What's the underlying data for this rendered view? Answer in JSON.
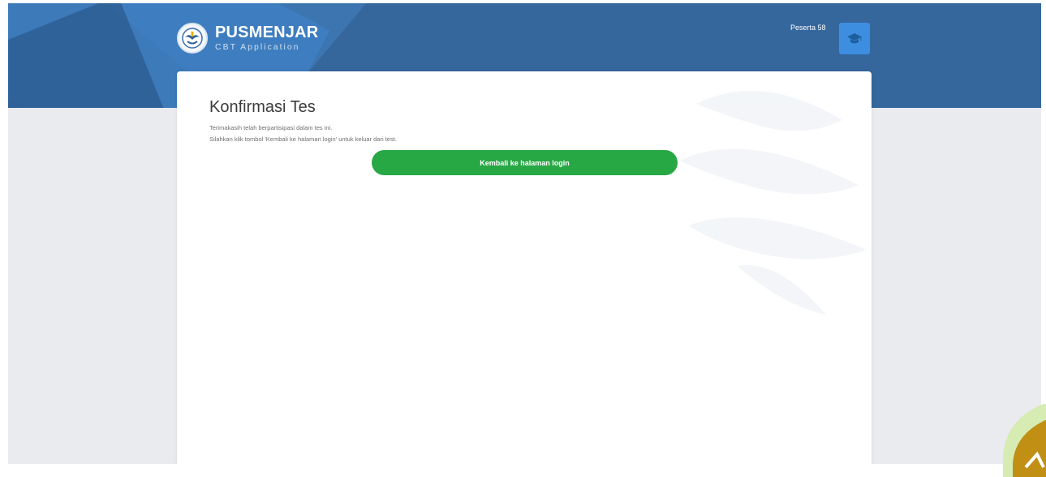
{
  "header": {
    "brand_title": "PUSMENJAR",
    "brand_subtitle": "CBT Application",
    "user_name": "Peserta 58",
    "user_icon": "graduation-cap-icon"
  },
  "confirmation": {
    "title": "Konfirmasi Tes",
    "message_line1": "Terimakasih telah berpartisipasi dalam tes ini.",
    "message_line2": "Silahkan klik tombol 'Kembali ke halaman login' untuk keluar dari test.",
    "login_button_label": "Kembali ke halaman login"
  },
  "colors": {
    "header_bg": "#35679d",
    "page_bg": "#e9ebef",
    "button_bg": "#28a745",
    "avatar_bg": "#3d8ee0"
  }
}
